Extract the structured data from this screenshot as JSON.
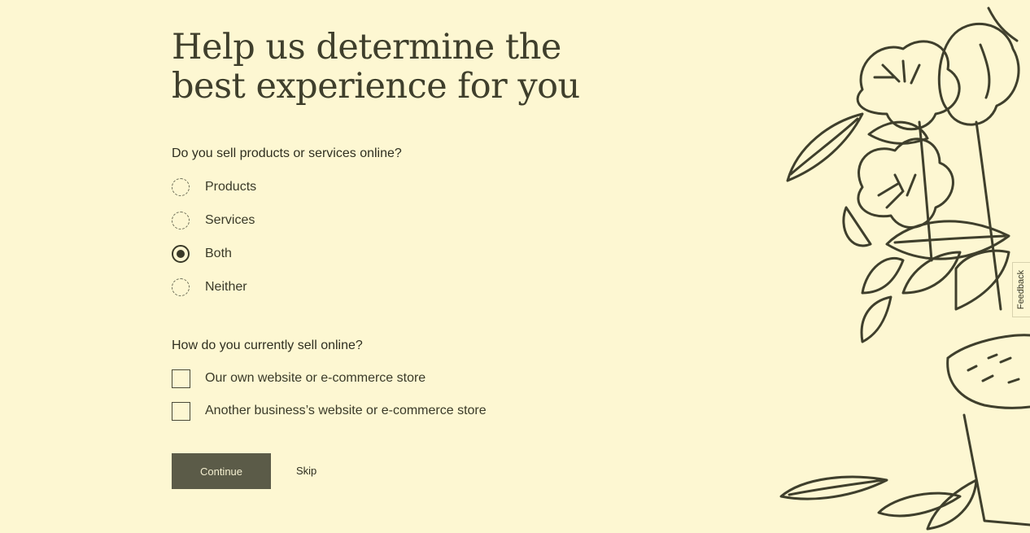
{
  "heading": {
    "line1": "Help us determine the",
    "line2": "best experience for you"
  },
  "question1": {
    "label": "Do you sell products or services online?",
    "options": [
      {
        "label": "Products",
        "selected": false
      },
      {
        "label": "Services",
        "selected": false
      },
      {
        "label": "Both",
        "selected": true
      },
      {
        "label": "Neither",
        "selected": false
      }
    ]
  },
  "question2": {
    "label": "How do you currently sell online?",
    "options": [
      {
        "label": "Our own website or e-commerce store",
        "checked": false
      },
      {
        "label": "Another business’s website or e-commerce store",
        "checked": false
      }
    ]
  },
  "actions": {
    "continue_label": "Continue",
    "skip_label": "Skip"
  },
  "feedback": {
    "label": "Feedback"
  },
  "colors": {
    "background": "#fdf7d2",
    "ink": "#3a3a28",
    "button": "#5b5b48"
  }
}
